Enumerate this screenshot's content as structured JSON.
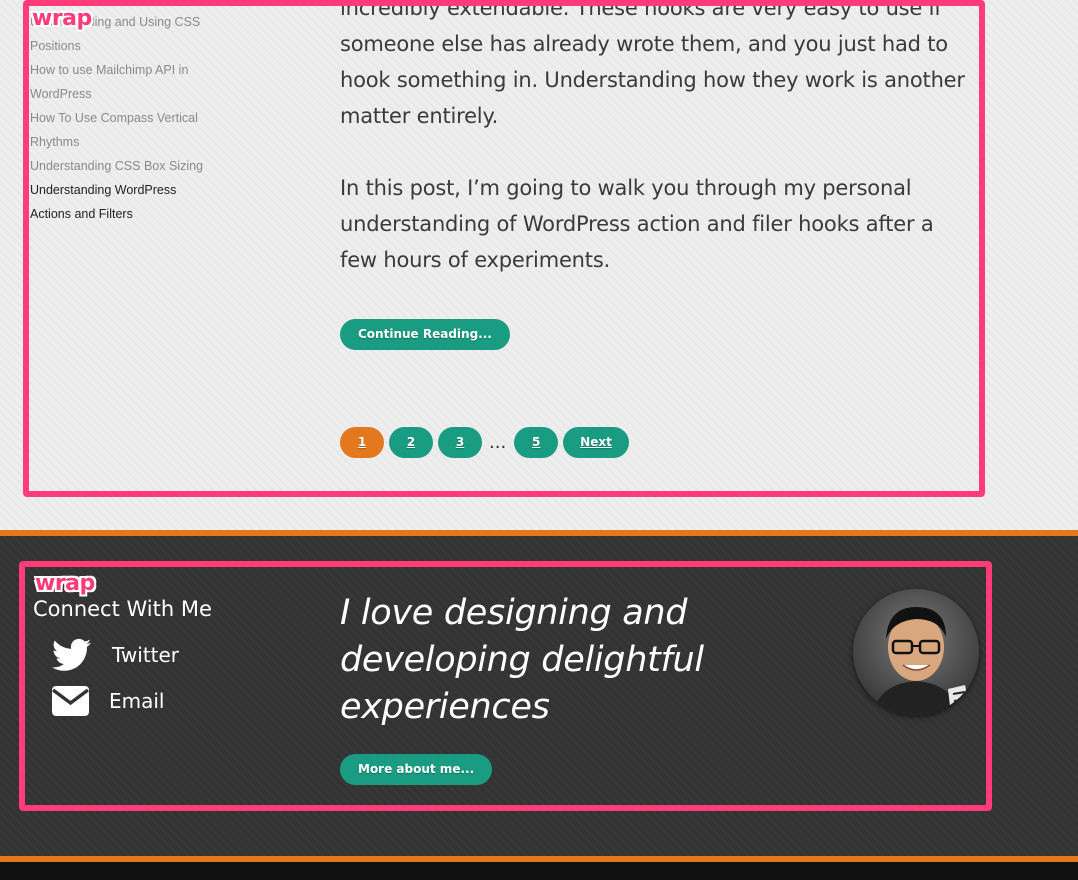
{
  "annotation": {
    "label": "wrap",
    "color": "#ff3b7a"
  },
  "sidebar": {
    "links": [
      {
        "text": "Understanding and Using CSS Positions",
        "current": false
      },
      {
        "text": "How to use Mailchimp API in WordPress",
        "current": false
      },
      {
        "text": "How To Use Compass Vertical Rhythms",
        "current": false
      },
      {
        "text": "Understanding CSS Box Sizing",
        "current": false
      },
      {
        "text": "Understanding WordPress Actions and Filters",
        "current": true
      }
    ]
  },
  "article": {
    "paragraphs": [
      "incredibly extendable. These hooks are very easy to use if someone else has already wrote them, and you just had to hook something in. Understanding how they work is another matter entirely.",
      "In this post, I’m going to walk you through my personal understanding of WordPress action and filer hooks after a few hours of experiments."
    ],
    "continue_label": "Continue Reading..."
  },
  "pagination": {
    "pages": [
      "1",
      "2",
      "3"
    ],
    "ellipsis": "...",
    "last_page": "5",
    "next_label": "Next",
    "active_page": "1"
  },
  "footer": {
    "connect_title": "Connect With Me",
    "social": [
      {
        "label": "Twitter",
        "icon": "twitter-bird-icon"
      },
      {
        "label": "Email",
        "icon": "envelope-icon"
      }
    ],
    "tagline": "I love designing and developing delightful experiences",
    "more_label": "More about me...",
    "avatar": "profile-photo"
  },
  "colors": {
    "accent_green": "#1a9c83",
    "accent_orange": "#e3781e",
    "annotation_pink": "#ff3b7a",
    "footer_bg": "#333333"
  }
}
